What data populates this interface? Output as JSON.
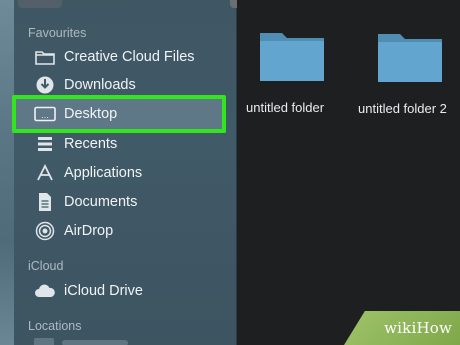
{
  "sidebar": {
    "sections": [
      {
        "title": "Favourites",
        "items": [
          {
            "label": "Creative Cloud Files",
            "icon": "folder-icon"
          },
          {
            "label": "Downloads",
            "icon": "download-icon"
          },
          {
            "label": "Desktop",
            "icon": "desktop-icon",
            "selected": true
          },
          {
            "label": "Recents",
            "icon": "recents-icon"
          },
          {
            "label": "Applications",
            "icon": "applications-icon"
          },
          {
            "label": "Documents",
            "icon": "document-icon"
          },
          {
            "label": "AirDrop",
            "icon": "airdrop-icon"
          }
        ]
      },
      {
        "title": "iCloud",
        "items": [
          {
            "label": "iCloud Drive",
            "icon": "cloud-icon"
          }
        ]
      },
      {
        "title": "Locations",
        "items": []
      }
    ]
  },
  "content": {
    "folders": [
      {
        "label": "untitled folder"
      },
      {
        "label": "untitled folder 2"
      }
    ]
  },
  "watermark": {
    "text": "wikiHow"
  },
  "colors": {
    "sidebar_bg": "#415a68",
    "selected_bg": "#5e7888",
    "highlight": "#33e51c",
    "folder_blue": "#62a6cf",
    "content_bg": "#1e1f21"
  }
}
